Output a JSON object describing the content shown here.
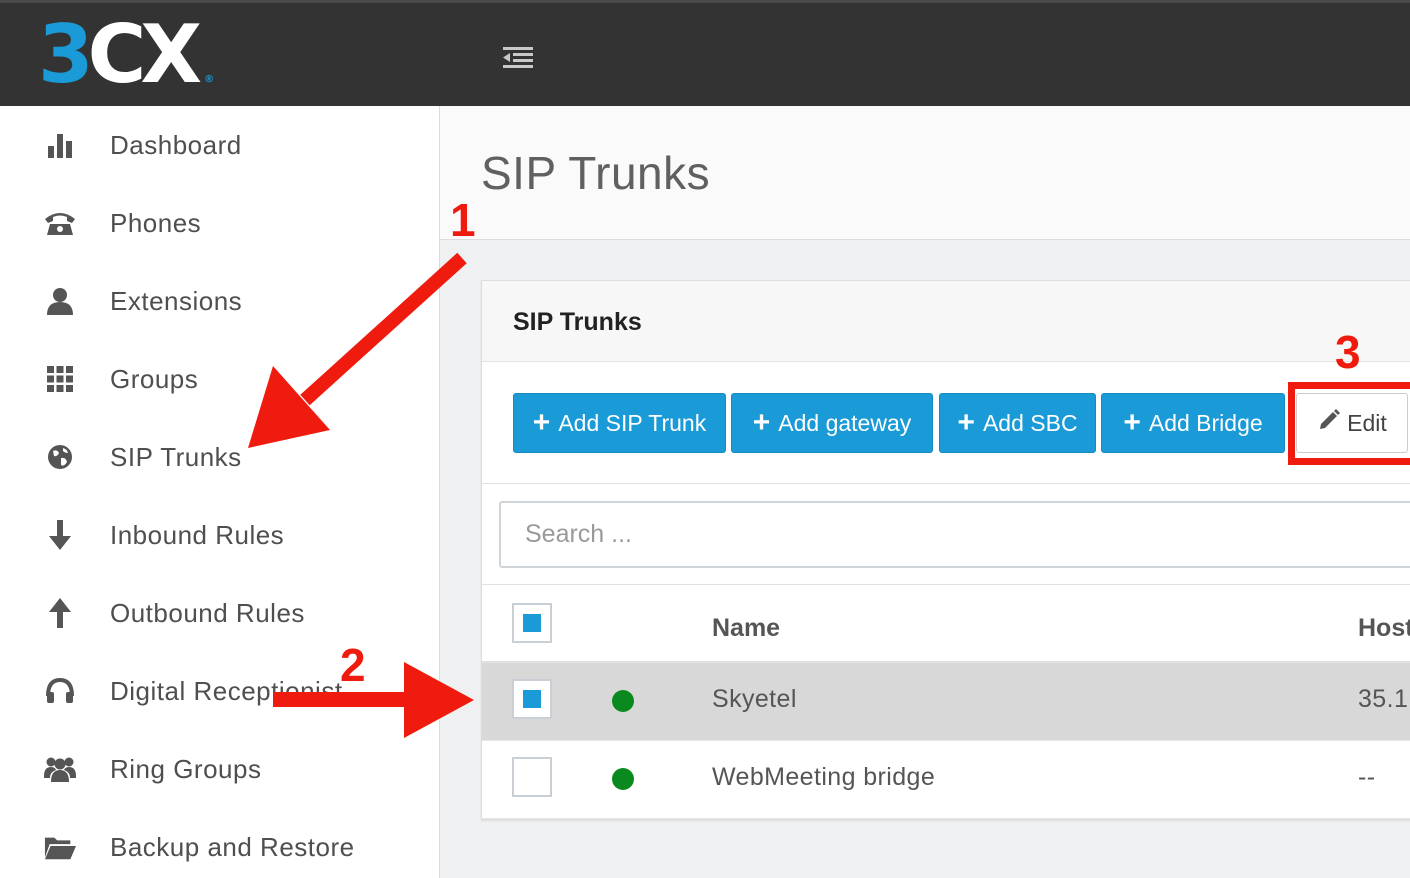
{
  "header": {
    "logo_num": "3",
    "logo_text": "CX",
    "logo_mark": "®",
    "menu_icon": "menu-collapse-icon"
  },
  "sidebar": {
    "items": [
      {
        "label": "Dashboard",
        "icon": "bar-chart-icon"
      },
      {
        "label": "Phones",
        "icon": "phone-icon"
      },
      {
        "label": "Extensions",
        "icon": "user-icon"
      },
      {
        "label": "Groups",
        "icon": "grid-icon"
      },
      {
        "label": "SIP Trunks",
        "icon": "globe-icon"
      },
      {
        "label": "Inbound Rules",
        "icon": "arrow-down-icon"
      },
      {
        "label": "Outbound Rules",
        "icon": "arrow-up-icon"
      },
      {
        "label": "Digital Receptionist",
        "icon": "headset-icon"
      },
      {
        "label": "Ring Groups",
        "icon": "users-icon"
      },
      {
        "label": "Backup and Restore",
        "icon": "folder-icon"
      }
    ]
  },
  "main": {
    "page_title": "SIP Trunks",
    "panel_title": "SIP Trunks",
    "buttons": {
      "add_sip_trunk": "Add SIP Trunk",
      "add_gateway": "Add gateway",
      "add_sbc": "Add SBC",
      "add_bridge": "Add Bridge",
      "edit": "Edit"
    },
    "search": {
      "placeholder": "Search ...",
      "value": ""
    },
    "table": {
      "columns": [
        "Name",
        "Host"
      ],
      "rows": [
        {
          "name": "Skyetel",
          "host": "35.1",
          "status": "green",
          "selected": true
        },
        {
          "name": "WebMeeting bridge",
          "host": "--",
          "status": "green",
          "selected": false
        }
      ]
    }
  },
  "annotations": {
    "labels": [
      "1",
      "2",
      "3"
    ],
    "color": "#f01b0f"
  },
  "colors": {
    "accent": "#1a9ad6",
    "topbar": "#333333",
    "status_green": "#0a8a1e"
  }
}
